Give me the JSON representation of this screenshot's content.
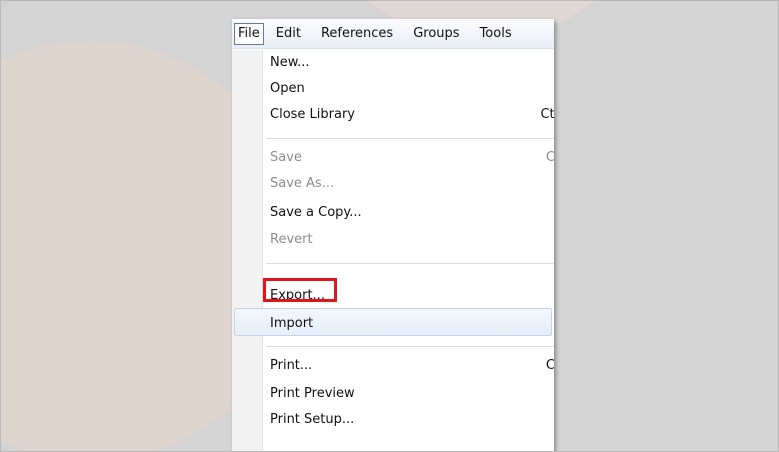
{
  "menubar": {
    "items": [
      "File",
      "Edit",
      "References",
      "Groups",
      "Tools"
    ]
  },
  "file_menu": {
    "items": [
      {
        "label": "New...",
        "shortcut": "",
        "enabled": true
      },
      {
        "label": "Open",
        "shortcut": "",
        "enabled": true
      },
      {
        "label": "Close Library",
        "shortcut": "Ctr",
        "enabled": true
      },
      {
        "label": "Save",
        "shortcut": "Ct",
        "enabled": false
      },
      {
        "label": "Save As...",
        "shortcut": "",
        "enabled": false
      },
      {
        "label": "Save a Copy...",
        "shortcut": "",
        "enabled": true
      },
      {
        "label": "Revert",
        "shortcut": "",
        "enabled": false
      },
      {
        "label": "Export...",
        "shortcut": "",
        "enabled": true,
        "highlighted": true
      },
      {
        "label": "Import",
        "shortcut": "",
        "enabled": true
      },
      {
        "label": "Print...",
        "shortcut": "Ct",
        "enabled": true
      },
      {
        "label": "Print Preview",
        "shortcut": "",
        "enabled": true
      },
      {
        "label": "Print Setup...",
        "shortcut": "",
        "enabled": true
      }
    ]
  },
  "colors": {
    "highlight_border": "#e0141b",
    "hover_background": "#e6eef9",
    "disabled_text": "#8c8c8c"
  }
}
